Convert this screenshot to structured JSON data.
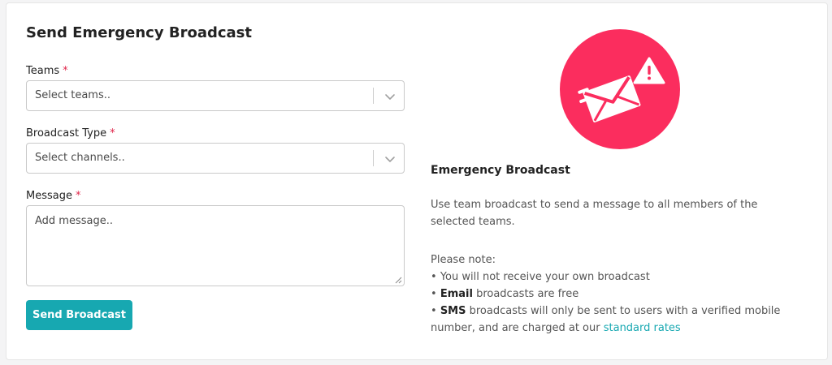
{
  "form": {
    "title": "Send Emergency Broadcast",
    "required_marker": "*",
    "teams": {
      "label": "Teams",
      "placeholder": "Select teams.."
    },
    "broadcast_type": {
      "label": "Broadcast Type",
      "placeholder": "Select channels.."
    },
    "message": {
      "label": "Message",
      "placeholder": "Add message.."
    },
    "submit_label": "Send Broadcast"
  },
  "info": {
    "title": "Emergency Broadcast",
    "description": "Use team broadcast to send a message to all members of the selected teams.",
    "note_heading": "Please note:",
    "bullet": "•",
    "note1": "You will not receive your own broadcast",
    "note2_bold": "Email",
    "note2_rest": "broadcasts are free",
    "note3_bold": "SMS",
    "note3_rest": "broadcasts will only be sent to users with a verified mobile number, and are charged at our",
    "note3_link": "standard rates"
  },
  "colors": {
    "accent": "#17a8b1",
    "hero": "#fb2d5e",
    "required": "#e0264a"
  },
  "icons": {
    "hero": "envelope-alert-icon",
    "dropdown": "chevron-down-icon",
    "resize": "resize-grip-icon"
  }
}
